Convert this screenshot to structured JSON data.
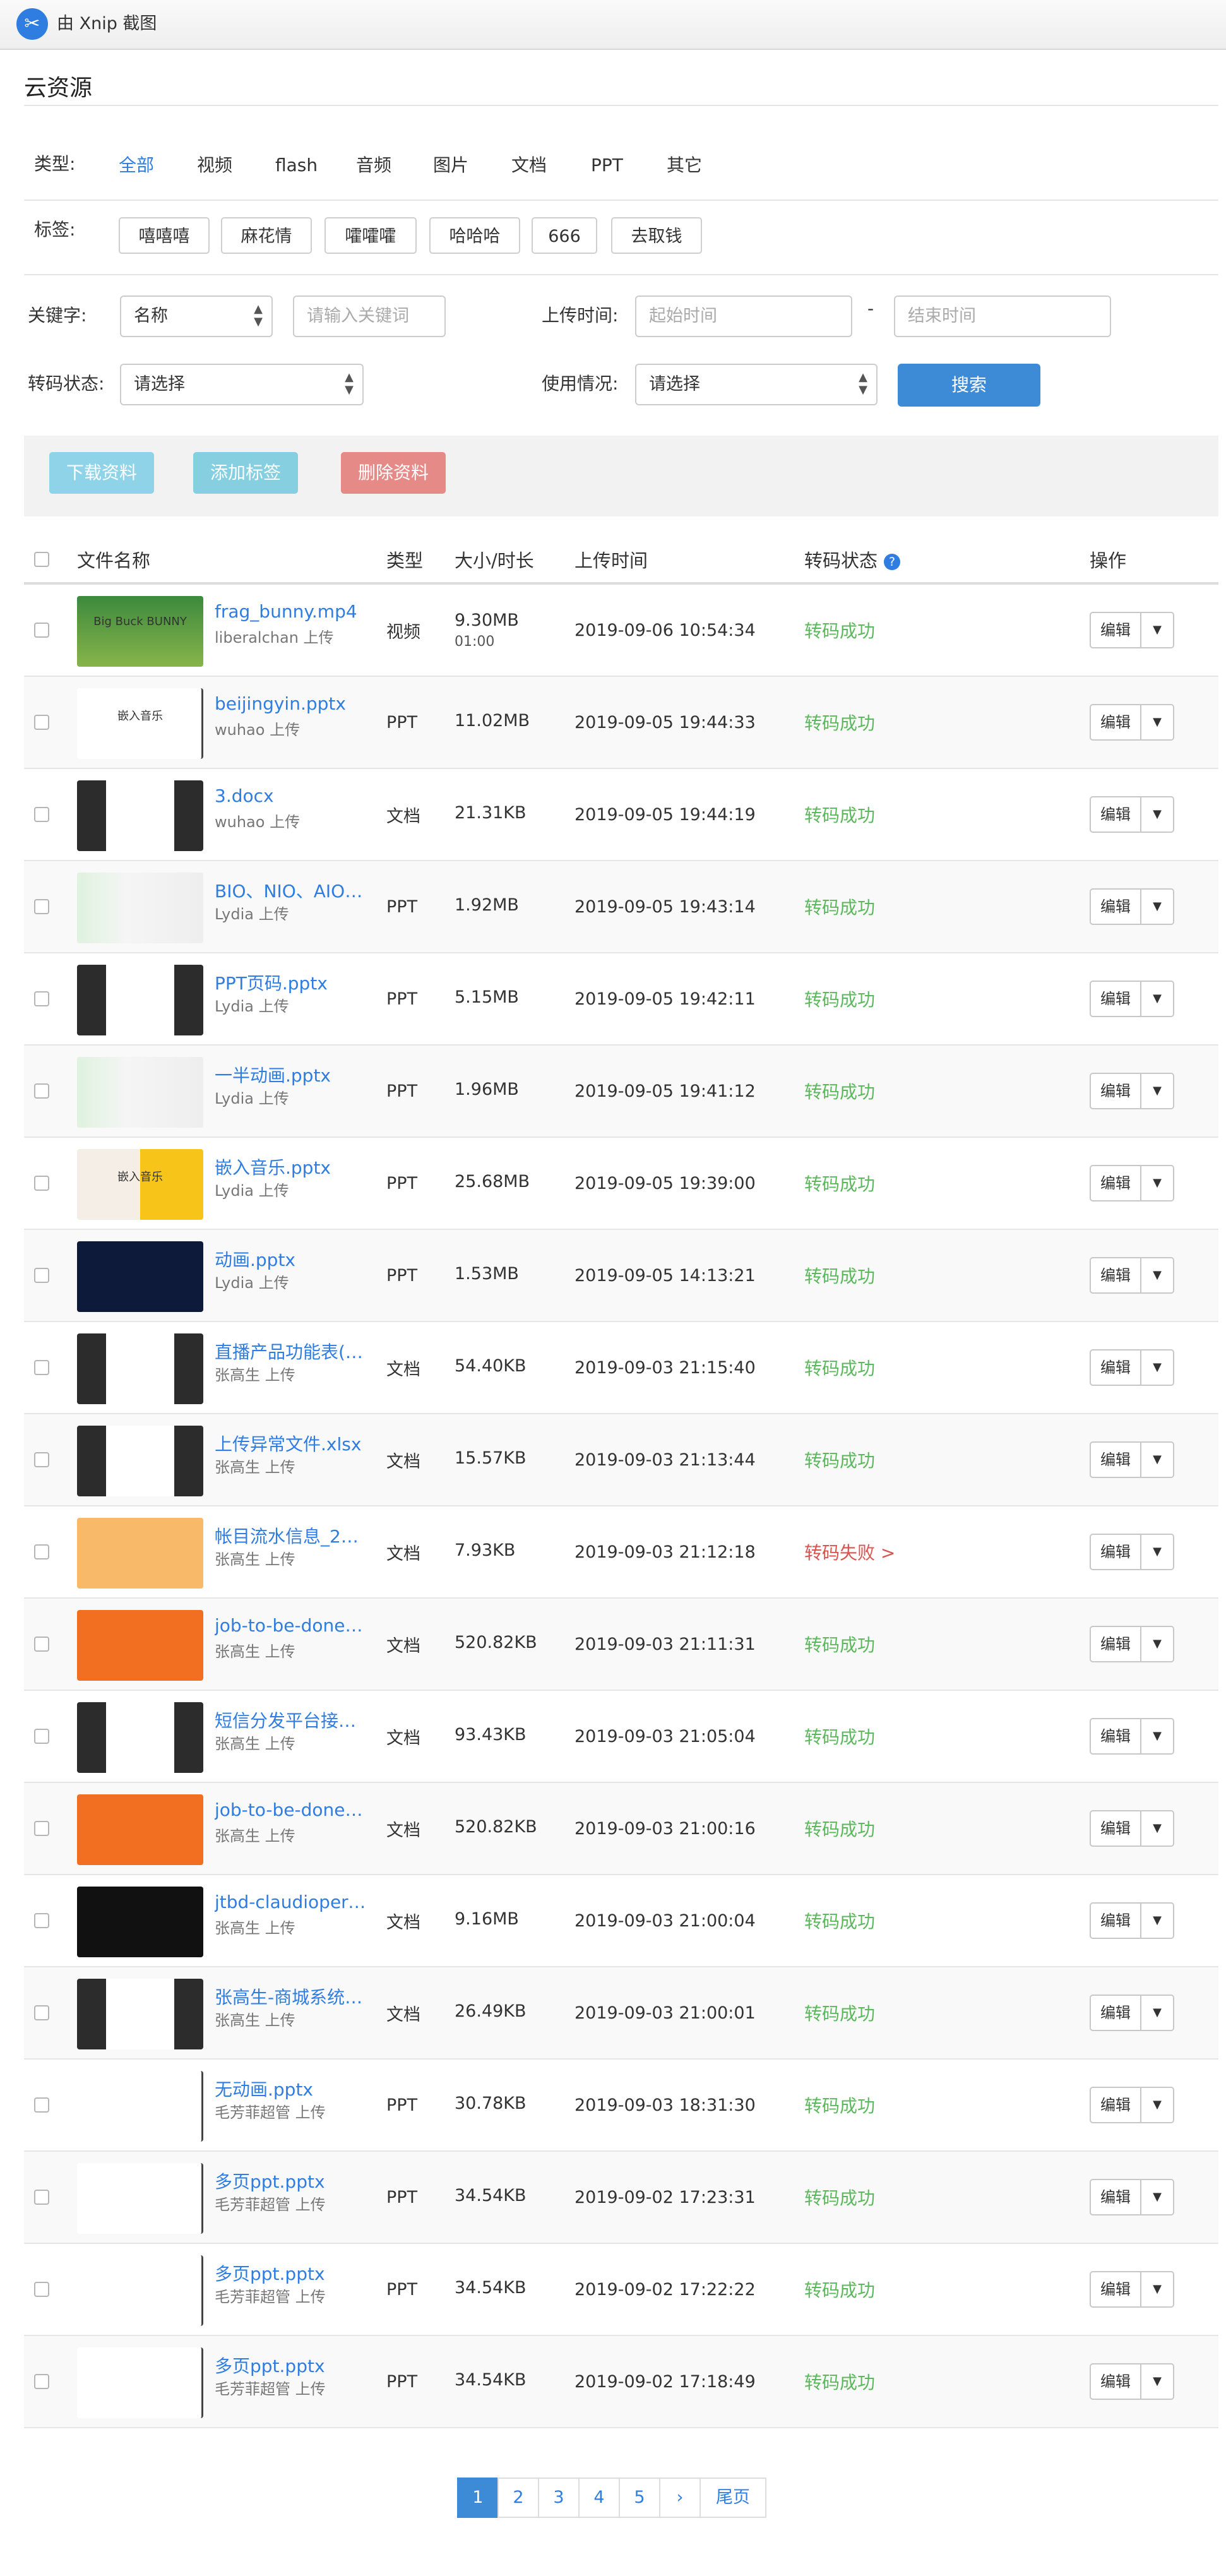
{
  "app": {
    "title": "由 Xnip 截图"
  },
  "page": {
    "title": "云资源"
  },
  "filters": {
    "type_label": "类型:",
    "types": [
      "全部",
      "视频",
      "flash",
      "音频",
      "图片",
      "文档",
      "PPT",
      "其它"
    ],
    "tags_label": "标签:",
    "tags": [
      "嘻嘻嘻",
      "麻花情",
      "嚯嚯嚯",
      "哈哈哈",
      "666",
      "去取钱"
    ],
    "keyword_label": "关键字:",
    "keyword_select": "名称",
    "keyword_placeholder": "请输入关键词",
    "upload_time_label": "上传时间:",
    "start_placeholder": "起始时间",
    "end_placeholder": "结束时间",
    "date_separator": "-",
    "transcode_label": "转码状态:",
    "transcode_select": "请选择",
    "usage_label": "使用情况:",
    "usage_select": "请选择",
    "search_button": "搜索"
  },
  "actions": {
    "download": "下载资料",
    "add_tag": "添加标签",
    "delete": "删除资料"
  },
  "table": {
    "columns": {
      "name": "文件名称",
      "type": "类型",
      "size": "大小/时长",
      "time": "上传时间",
      "status": "转码状态",
      "ops": "操作"
    },
    "edit_label": "编辑",
    "rows": [
      {
        "name": "frag_bunny.mp4",
        "uploader": "liberalchan 上传",
        "type": "视频",
        "size": "9.30MB",
        "duration": "01:00",
        "time": "2019-09-06 10:54:34",
        "status": "转码成功",
        "thumb": "bunny",
        "thumb_text": "Big Buck BUNNY"
      },
      {
        "name": "beijingyin.pptx",
        "uploader": "wuhao 上传",
        "type": "PPT",
        "size": "11.02MB",
        "duration": "",
        "time": "2019-09-05 19:44:33",
        "status": "转码成功",
        "thumb": "white",
        "thumb_text": "嵌入音乐"
      },
      {
        "name": "3.docx",
        "uploader": "wuhao 上传",
        "type": "文档",
        "size": "21.31KB",
        "duration": "",
        "time": "2019-09-05 19:44:19",
        "status": "转码成功",
        "thumb": "dark",
        "thumb_text": ""
      },
      {
        "name": "BIO、NIO、AIO…",
        "uploader": "Lydia 上传",
        "type": "PPT",
        "size": "1.92MB",
        "duration": "",
        "time": "2019-09-05 19:43:14",
        "status": "转码成功",
        "thumb": "green",
        "thumb_text": ""
      },
      {
        "name": "PPT页码.pptx",
        "uploader": "Lydia 上传",
        "type": "PPT",
        "size": "5.15MB",
        "duration": "",
        "time": "2019-09-05 19:42:11",
        "status": "转码成功",
        "thumb": "dark",
        "thumb_text": ""
      },
      {
        "name": "一半动画.pptx",
        "uploader": "Lydia 上传",
        "type": "PPT",
        "size": "1.96MB",
        "duration": "",
        "time": "2019-09-05 19:41:12",
        "status": "转码成功",
        "thumb": "green",
        "thumb_text": ""
      },
      {
        "name": "嵌入音乐.pptx",
        "uploader": "Lydia 上传",
        "type": "PPT",
        "size": "25.68MB",
        "duration": "",
        "time": "2019-09-05 19:39:00",
        "status": "转码成功",
        "thumb": "yellow",
        "thumb_text": "嵌入音乐"
      },
      {
        "name": "动画.pptx",
        "uploader": "Lydia 上传",
        "type": "PPT",
        "size": "1.53MB",
        "duration": "",
        "time": "2019-09-05 14:13:21",
        "status": "转码成功",
        "thumb": "navy",
        "thumb_text": ""
      },
      {
        "name": "直播产品功能表(…",
        "uploader": "张高生 上传",
        "type": "文档",
        "size": "54.40KB",
        "duration": "",
        "time": "2019-09-03 21:15:40",
        "status": "转码成功",
        "thumb": "dark",
        "thumb_text": ""
      },
      {
        "name": "上传异常文件.xlsx",
        "uploader": "张高生 上传",
        "type": "文档",
        "size": "15.57KB",
        "duration": "",
        "time": "2019-09-03 21:13:44",
        "status": "转码成功",
        "thumb": "dark",
        "thumb_text": ""
      },
      {
        "name": "帐目流水信息_2…",
        "uploader": "张高生 上传",
        "type": "文档",
        "size": "7.93KB",
        "duration": "",
        "time": "2019-09-03 21:12:18",
        "status": "转码失败 >",
        "thumb": "peach",
        "thumb_text": ""
      },
      {
        "name": "job-to-be-done.…",
        "uploader": "张高生 上传",
        "type": "文档",
        "size": "520.82KB",
        "duration": "",
        "time": "2019-09-03 21:11:31",
        "status": "转码成功",
        "thumb": "orange",
        "thumb_text": ""
      },
      {
        "name": "短信分发平台接…",
        "uploader": "张高生 上传",
        "type": "文档",
        "size": "93.43KB",
        "duration": "",
        "time": "2019-09-03 21:05:04",
        "status": "转码成功",
        "thumb": "dark",
        "thumb_text": ""
      },
      {
        "name": "job-to-be-done.…",
        "uploader": "张高生 上传",
        "type": "文档",
        "size": "520.82KB",
        "duration": "",
        "time": "2019-09-03 21:00:16",
        "status": "转码成功",
        "thumb": "orange",
        "thumb_text": ""
      },
      {
        "name": "jtbd-claudioperr…",
        "uploader": "张高生 上传",
        "type": "文档",
        "size": "9.16MB",
        "duration": "",
        "time": "2019-09-03 21:00:04",
        "status": "转码成功",
        "thumb": "black",
        "thumb_text": ""
      },
      {
        "name": "张高生-商城系统…",
        "uploader": "张高生 上传",
        "type": "文档",
        "size": "26.49KB",
        "duration": "",
        "time": "2019-09-03 21:00:01",
        "status": "转码成功",
        "thumb": "dark",
        "thumb_text": ""
      },
      {
        "name": "无动画.pptx",
        "uploader": "毛芳菲超管 上传",
        "type": "PPT",
        "size": "30.78KB",
        "duration": "",
        "time": "2019-09-03 18:31:30",
        "status": "转码成功",
        "thumb": "white",
        "thumb_text": ""
      },
      {
        "name": "多页ppt.pptx",
        "uploader": "毛芳菲超管 上传",
        "type": "PPT",
        "size": "34.54KB",
        "duration": "",
        "time": "2019-09-02 17:23:31",
        "status": "转码成功",
        "thumb": "white",
        "thumb_text": ""
      },
      {
        "name": "多页ppt.pptx",
        "uploader": "毛芳菲超管 上传",
        "type": "PPT",
        "size": "34.54KB",
        "duration": "",
        "time": "2019-09-02 17:22:22",
        "status": "转码成功",
        "thumb": "white",
        "thumb_text": ""
      },
      {
        "name": "多页ppt.pptx",
        "uploader": "毛芳菲超管 上传",
        "type": "PPT",
        "size": "34.54KB",
        "duration": "",
        "time": "2019-09-02 17:18:49",
        "status": "转码成功",
        "thumb": "white",
        "thumb_text": ""
      }
    ]
  },
  "pagination": {
    "pages": [
      "1",
      "2",
      "3",
      "4",
      "5"
    ],
    "next": "›",
    "last": "尾页",
    "current": "1"
  },
  "colors": {
    "accent": "#2f7de1",
    "success": "#5cb85c",
    "danger": "#d9534f",
    "download": "#8fd3e8",
    "add_tag": "#86cfe1",
    "delete": "#e68a88"
  }
}
